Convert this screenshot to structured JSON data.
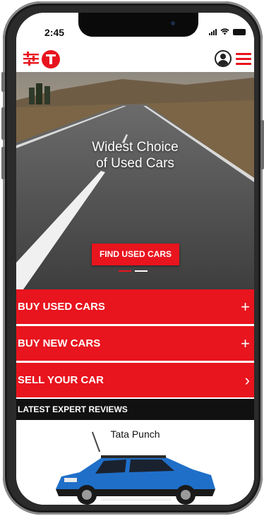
{
  "status_bar": {
    "time": "2:45"
  },
  "hero": {
    "title_line1": "Widest Choice",
    "title_line2": "of Used Cars",
    "cta_label": "FIND USED CARS",
    "carousel_slides": 2,
    "active_slide": 1
  },
  "actions": [
    {
      "label": "BUY USED CARS",
      "glyph": "+"
    },
    {
      "label": "BUY NEW CARS",
      "glyph": "+"
    },
    {
      "label": "SELL YOUR CAR",
      "glyph": "›"
    }
  ],
  "reviews": {
    "heading": "LATEST EXPERT REVIEWS",
    "item_title": "Tata Punch"
  },
  "colors": {
    "brand_red": "#e8141e",
    "dark": "#111111"
  },
  "icons": [
    "filter-icon",
    "brand-logo-icon",
    "user-account-icon",
    "hamburger-menu-icon"
  ]
}
